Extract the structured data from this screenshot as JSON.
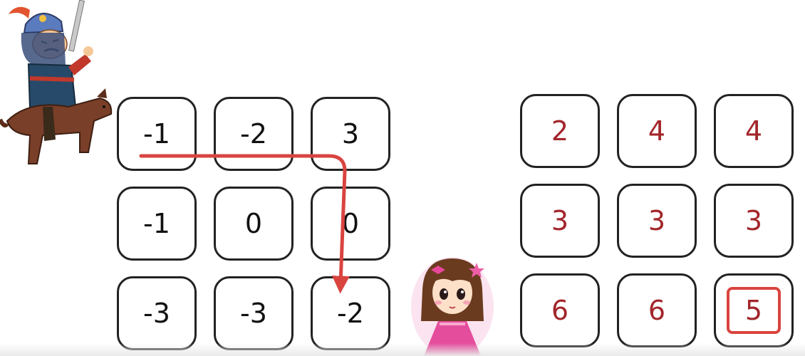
{
  "left_grid": {
    "rows": [
      [
        "-1",
        "-2",
        "3"
      ],
      [
        "-1",
        "0",
        "0"
      ],
      [
        "-3",
        "-3",
        "-2"
      ]
    ]
  },
  "right_grid": {
    "rows": [
      [
        "2",
        "4",
        "4"
      ],
      [
        "3",
        "3",
        "3"
      ],
      [
        "6",
        "6",
        "5"
      ]
    ],
    "highlighted_value": "5"
  },
  "path_arrow": {
    "color": "#d9443f",
    "route": "row 1 right to column 3, then down to row 3"
  },
  "colors": {
    "cell_border": "#222222",
    "right_values": "#a2262b",
    "highlight": "#d9443f"
  },
  "illustrations": {
    "knight": "knight-on-horse-illustration",
    "princess": "princess-illustration"
  }
}
